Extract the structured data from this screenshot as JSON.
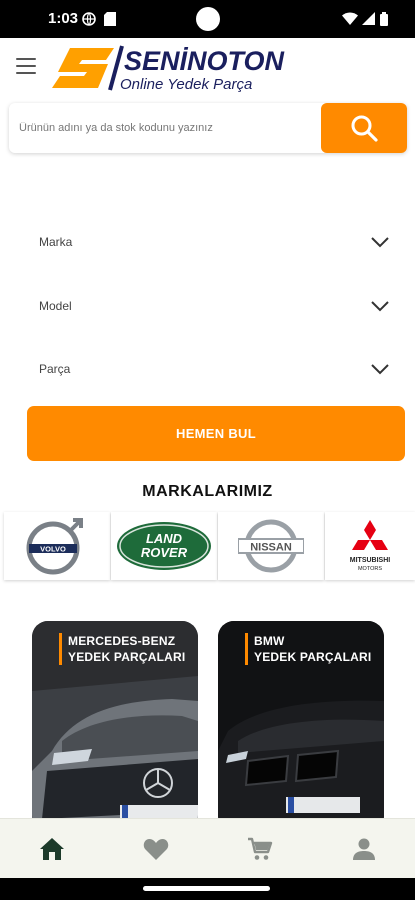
{
  "status_bar": {
    "time": "1:03"
  },
  "app": {
    "brand_name": "SENİNOTON",
    "brand_tagline": "Online Yedek Parça"
  },
  "search": {
    "placeholder": "Ürünün adını ya da stok kodunu yazınız"
  },
  "filters": [
    {
      "label": "Marka"
    },
    {
      "label": "Model"
    },
    {
      "label": "Parça"
    }
  ],
  "find_button_label": "HEMEN BUL",
  "brands_section": {
    "title": "MARKALARIMIZ",
    "brands": [
      {
        "name": "VOLVO"
      },
      {
        "name": "LAND ROVER",
        "line1": "LAND",
        "line2": "ROVER"
      },
      {
        "name": "NISSAN"
      },
      {
        "name": "MITSUBISHI MOTORS",
        "line1": "MITSUBISHI",
        "line2": "MOTORS"
      }
    ]
  },
  "categories": [
    {
      "line1": "MERCEDES-BENZ",
      "line2": "YEDEK PARÇALARI"
    },
    {
      "line1": "BMW",
      "line2": "YEDEK PARÇALARI"
    }
  ],
  "bottom_nav": [
    {
      "icon": "home-icon",
      "active": true
    },
    {
      "icon": "heart-icon",
      "active": false
    },
    {
      "icon": "cart-icon",
      "active": false
    },
    {
      "icon": "profile-icon",
      "active": false
    }
  ],
  "colors": {
    "accent": "#ff8a00",
    "brand_navy": "#1a1f5e",
    "nav_active": "#1c3a2a",
    "nav_inactive": "#8a8f8a"
  }
}
